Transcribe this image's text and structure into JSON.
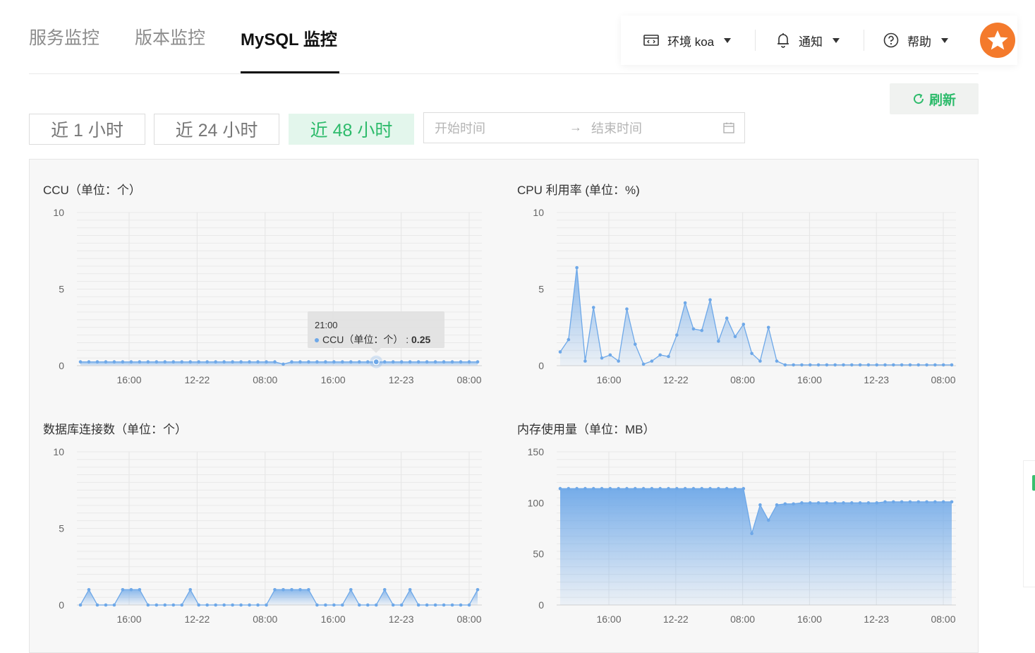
{
  "tabs": [
    {
      "label": "服务监控",
      "active": false
    },
    {
      "label": "版本监控",
      "active": false
    },
    {
      "label": "MySQL 监控",
      "active": true
    }
  ],
  "topbar": {
    "env_label": "环境 koa",
    "notify_label": "通知",
    "help_label": "帮助"
  },
  "toolbar": {
    "refresh_label": "刷新",
    "ranges": [
      "近 1 小时",
      "近 24 小时",
      "近 48 小时"
    ],
    "active_range": "近 48 小时",
    "start_placeholder": "开始时间",
    "end_placeholder": "结束时间",
    "arrow": "→"
  },
  "colors": {
    "accent": "#2dbb6b",
    "accent_bg": "#e3f6ec",
    "series_line": "#6ea8e8",
    "avatar": "#f47a2c"
  },
  "tooltip": {
    "time": "21:00",
    "series": "CCU（单位：个）",
    "value": "0.25"
  },
  "chart_data": [
    {
      "id": "ccu",
      "type": "area",
      "title": "CCU（单位：个）",
      "x_ticks": [
        "16:00",
        "12-22",
        "08:00",
        "16:00",
        "12-23",
        "08:00"
      ],
      "y_ticks": [
        0,
        5,
        10
      ],
      "ylim": [
        0,
        10
      ],
      "grid": true,
      "series": [
        {
          "values": [
            0.25,
            0.25,
            0.25,
            0.25,
            0.25,
            0.25,
            0.25,
            0.25,
            0.25,
            0.25,
            0.25,
            0.25,
            0.25,
            0.25,
            0.25,
            0.25,
            0.25,
            0.25,
            0.25,
            0.25,
            0.25,
            0.25,
            0.25,
            0.25,
            0.1,
            0.25,
            0.25,
            0.25,
            0.25,
            0.25,
            0.25,
            0.25,
            0.25,
            0.25,
            0.25,
            0.25,
            0.25,
            0.25,
            0.25,
            0.25,
            0.25,
            0.25,
            0.25,
            0.25,
            0.25,
            0.25,
            0.25,
            0.25
          ]
        }
      ]
    },
    {
      "id": "cpu",
      "type": "area",
      "title": "CPU 利用率 (单位：%)",
      "x_ticks": [
        "16:00",
        "12-22",
        "08:00",
        "16:00",
        "12-23",
        "08:00"
      ],
      "y_ticks": [
        0,
        5,
        10
      ],
      "ylim": [
        0,
        10
      ],
      "grid": true,
      "series": [
        {
          "values": [
            0.9,
            1.7,
            6.4,
            0.3,
            3.8,
            0.5,
            0.7,
            0.3,
            3.7,
            1.4,
            0.1,
            0.3,
            0.7,
            0.6,
            2.0,
            4.1,
            2.4,
            2.3,
            4.3,
            1.6,
            3.1,
            1.9,
            2.7,
            0.8,
            0.3,
            2.5,
            0.3,
            0.05,
            0.05,
            0.05,
            0.05,
            0.05,
            0.05,
            0.05,
            0.05,
            0.05,
            0.05,
            0.05,
            0.05,
            0.05,
            0.05,
            0.05,
            0.05,
            0.05,
            0.05,
            0.05,
            0.05,
            0.05
          ]
        }
      ]
    },
    {
      "id": "db_conn",
      "type": "area",
      "title": "数据库连接数（单位：个）",
      "x_ticks": [
        "16:00",
        "12-22",
        "08:00",
        "16:00",
        "12-23",
        "08:00"
      ],
      "y_ticks": [
        0,
        5,
        10
      ],
      "ylim": [
        0,
        10
      ],
      "grid": true,
      "series": [
        {
          "values": [
            0,
            1,
            0,
            0,
            0,
            1,
            1,
            1,
            0,
            0,
            0,
            0,
            0,
            1,
            0,
            0,
            0,
            0,
            0,
            0,
            0,
            0,
            0,
            1,
            1,
            1,
            1,
            1,
            0,
            0,
            0,
            0,
            1,
            0,
            0,
            0,
            1,
            0,
            0,
            1,
            0,
            0,
            0,
            0,
            0,
            0,
            0,
            1
          ]
        }
      ]
    },
    {
      "id": "memory",
      "type": "area",
      "title": "内存使用量（单位：MB）",
      "x_ticks": [
        "16:00",
        "12-22",
        "08:00",
        "16:00",
        "12-23",
        "08:00"
      ],
      "y_ticks": [
        0,
        50,
        100,
        150
      ],
      "ylim": [
        0,
        150
      ],
      "grid": true,
      "series": [
        {
          "values": [
            114,
            114,
            114,
            114,
            114,
            114,
            114,
            114,
            114,
            114,
            114,
            114,
            114,
            114,
            114,
            114,
            114,
            114,
            114,
            114,
            114,
            114,
            114,
            70,
            98,
            83,
            98,
            99,
            99,
            100,
            100,
            100,
            100,
            100,
            100,
            100,
            100,
            100,
            100,
            101,
            101,
            101,
            101,
            101,
            101,
            101,
            101,
            101
          ]
        }
      ]
    }
  ]
}
